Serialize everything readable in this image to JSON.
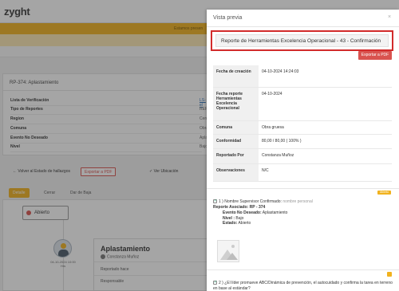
{
  "app": {
    "logo": "zyght",
    "banner": "Estamos presen"
  },
  "background": {
    "card_title": "RP-374: Aplastamiento",
    "rows": [
      {
        "label": "Lista de Verificación",
        "value": "LS-el"
      },
      {
        "label": "Tipo de Reportes",
        "value": "REPO"
      },
      {
        "label": "Region",
        "value": "Cent"
      },
      {
        "label": "Comuna",
        "value": "Obra"
      },
      {
        "label": "Evento No Deseado",
        "value": "Apla"
      },
      {
        "label": "Nivel",
        "value": "Bajo"
      }
    ],
    "actions": {
      "back": "← Volver al Estado de hallazgos",
      "pdf": "Exportar a PDF",
      "ver": "✓ Ver Ubicación"
    },
    "tabs": [
      "Detalle",
      "Cerrar",
      "Dar de Baja"
    ],
    "estado": "Abierto",
    "avatar_date": "04-10-2024 10:00 Hrs",
    "detail": {
      "title": "Aplastamiento",
      "user": "Constanza Muñoz",
      "labels": [
        "Reportado hace",
        "Responsable"
      ]
    }
  },
  "modal": {
    "title": "Vista previa",
    "close": "×",
    "heading": "Reporte de Herramientas Excelencia Operacional - 43  -  Confirmación",
    "export_label": "Exportar a PDF",
    "fields": [
      {
        "label": "Fecha de creación",
        "value": "04-10-2024 14:24:03"
      },
      {
        "label": "Fecha reporte Herramientas Excelencia Operacional",
        "value": "04-10-2024"
      },
      {
        "label": "Comuna",
        "value": "Obra gruesa"
      },
      {
        "label": "Conformidad",
        "value": "80,00 / 80,00 ( 100% )"
      },
      {
        "label": "Reportado Por",
        "value": "Constanza Muñoz"
      },
      {
        "label": "Observaciones",
        "value": "N/C"
      }
    ],
    "badge": "Abierto",
    "q1": {
      "text": "1 ) Nombre Supervisor Confirmado:",
      "muted": "nombre personal",
      "reporte_label": "Reporte Asociado:",
      "reporte_value": "RP - 374",
      "evento_label": "Evento No Deseado:",
      "evento_value": "Aplastamiento",
      "nivel_label": "Nivel :",
      "nivel_value": "Bajo",
      "estado_label": "Estado:",
      "estado_value": "Abierto"
    },
    "q2": {
      "text": "2 ) ¿El líder promueve ABC/Dinámica de prevención, el autocuidado y confirma la tarea en terreno en base al estándar?"
    }
  }
}
